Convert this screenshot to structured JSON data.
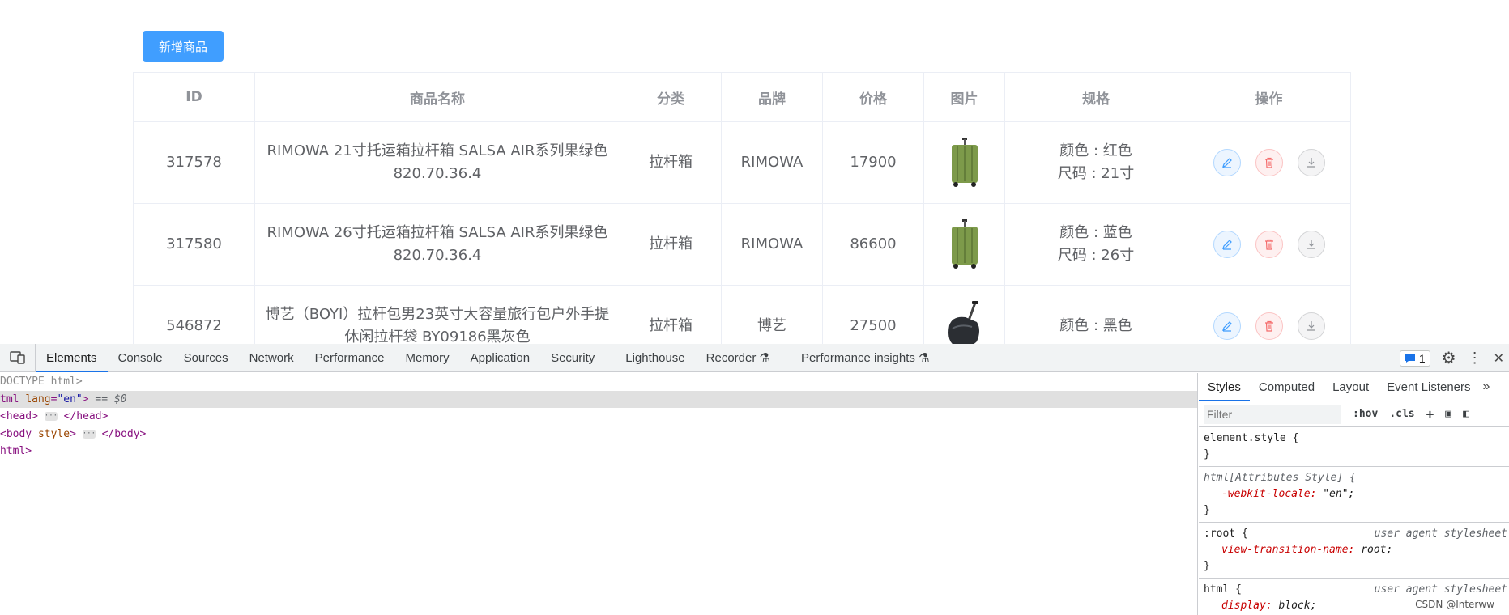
{
  "page": {
    "add_button": "新增商品",
    "columns": [
      "ID",
      "商品名称",
      "分类",
      "品牌",
      "价格",
      "图片",
      "规格",
      "操作"
    ],
    "rows": [
      {
        "id": "317578",
        "name": "RIMOWA 21寸托运箱拉杆箱 SALSA AIR系列果绿色 820.70.36.4",
        "category": "拉杆箱",
        "brand": "RIMOWA",
        "price": "17900",
        "image": "green-suitcase",
        "spec": [
          "颜色 : 红色",
          "尺码 : 21寸"
        ]
      },
      {
        "id": "317580",
        "name": "RIMOWA 26寸托运箱拉杆箱 SALSA AIR系列果绿色 820.70.36.4",
        "category": "拉杆箱",
        "brand": "RIMOWA",
        "price": "86600",
        "image": "green-suitcase",
        "spec": [
          "颜色 : 蓝色",
          "尺码 : 26寸"
        ]
      },
      {
        "id": "546872",
        "name": "博艺（BOYI）拉杆包男23英寸大容量旅行包户外手提休闲拉杆袋 BY09186黑灰色",
        "category": "拉杆箱",
        "brand": "博艺",
        "price": "27500",
        "image": "black-rolling-bag",
        "spec": [
          "颜色 : 黑色"
        ]
      }
    ],
    "row_actions": [
      "edit-icon",
      "delete-icon",
      "download-icon"
    ]
  },
  "devtools": {
    "tabs": [
      "Elements",
      "Console",
      "Sources",
      "Network",
      "Performance",
      "Memory",
      "Application",
      "Security",
      "Lighthouse",
      "Recorder",
      "Performance insights"
    ],
    "active_tab": "Elements",
    "issues_count": "1",
    "dom_lines": {
      "doctype": "DOCTYPE html>",
      "html_open_tag": "tml",
      "html_attr": "lang",
      "html_attr_val": "\"en\"",
      "html_selected": "== $0",
      "head_open": "<head>",
      "head_close": "</head>",
      "body_open": "<body",
      "body_attr": "style",
      "body_close": "</body>",
      "html_close": "html>"
    },
    "styles_tabs": [
      "Styles",
      "Computed",
      "Layout",
      "Event Listeners"
    ],
    "filter_placeholder": "Filter",
    "hov_label": ":hov",
    "cls_label": ".cls",
    "rules": [
      {
        "selector": "element.style {",
        "close": "}"
      },
      {
        "selector": "html[Attributes Style] {",
        "prop": "-webkit-locale",
        "value": "\"en\";",
        "close": "}"
      },
      {
        "selector": ":root {",
        "source": "user agent stylesheet",
        "prop": "view-transition-name",
        "value": "root;",
        "close": "}"
      },
      {
        "selector": "html {",
        "source": "user agent stylesheet",
        "prop": "display",
        "value": "block;",
        "close": "}"
      }
    ],
    "watermark": "CSDN @Interww"
  }
}
